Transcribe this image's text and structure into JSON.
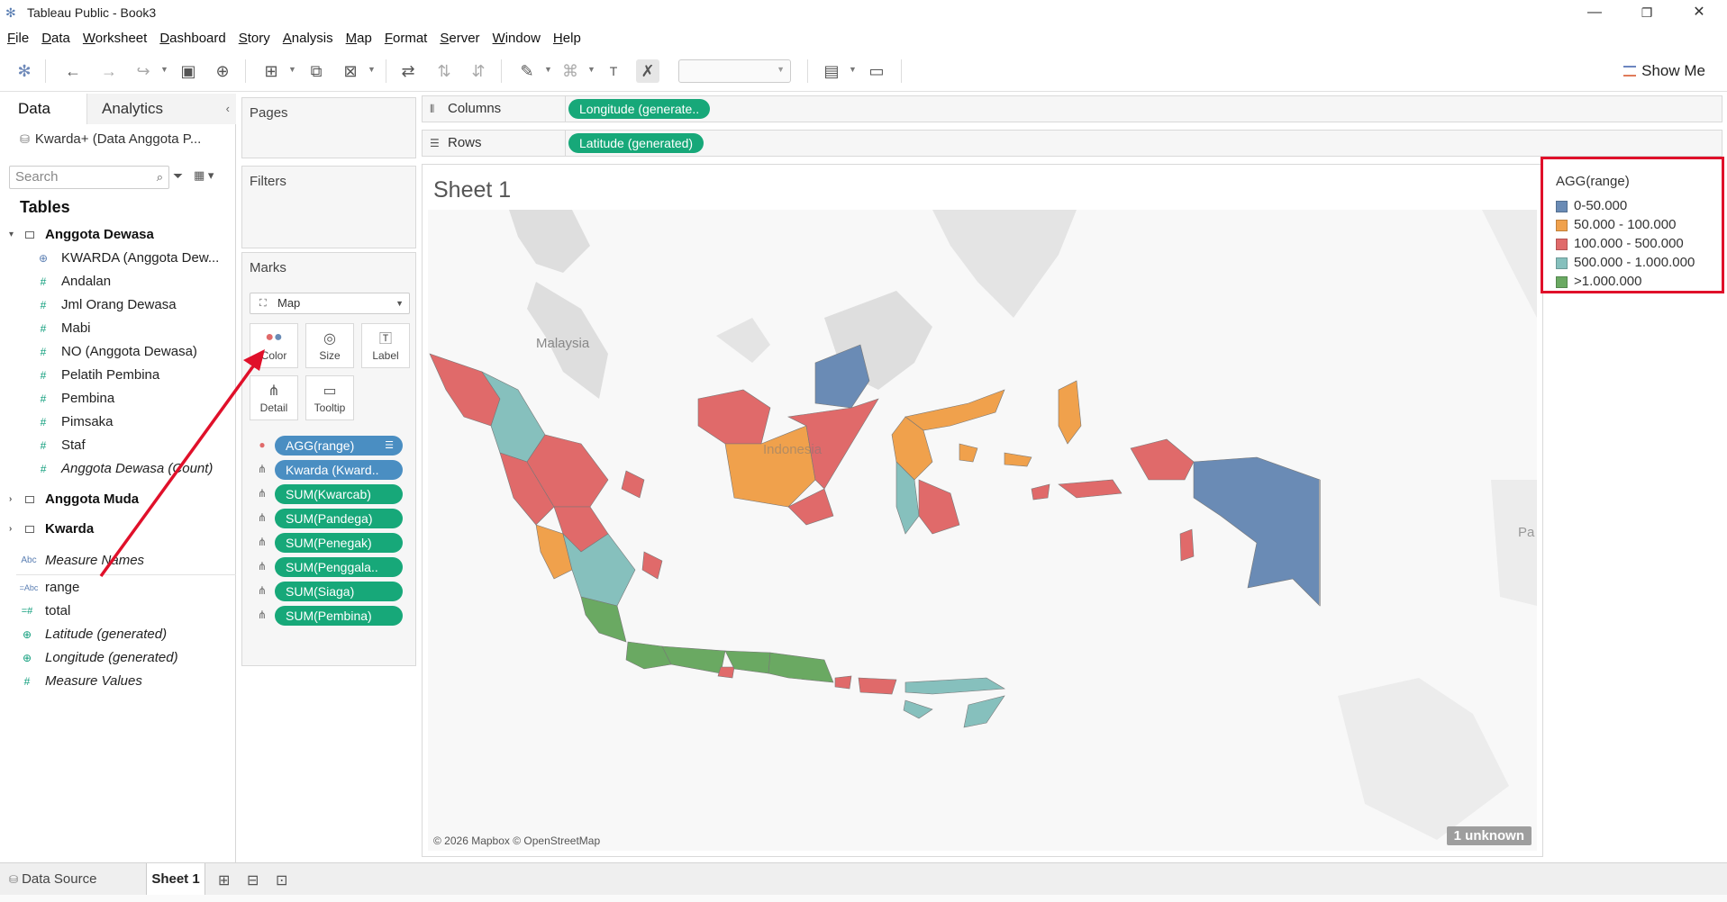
{
  "window": {
    "title": "Tableau Public - Book3",
    "controls": {
      "minimize": "—",
      "restore": "❐",
      "close": "✕"
    }
  },
  "menu": [
    "File",
    "Data",
    "Worksheet",
    "Dashboard",
    "Story",
    "Analysis",
    "Map",
    "Format",
    "Server",
    "Window",
    "Help"
  ],
  "toolbar": {
    "show_me_label": "Show Me"
  },
  "left_pane": {
    "tabs": {
      "data": "Data",
      "analytics": "Analytics"
    },
    "datasource": "Kwarda+ (Data Anggota P...",
    "search_placeholder": "Search",
    "tables_heading": "Tables",
    "tables": [
      {
        "name": "Anggota Dewasa",
        "expanded": true,
        "fields": [
          {
            "name": "KWARDA (Anggota Dew...",
            "type": "geo",
            "italic": false
          },
          {
            "name": "Andalan",
            "type": "measure",
            "italic": false
          },
          {
            "name": "Jml Orang Dewasa",
            "type": "measure",
            "italic": false
          },
          {
            "name": "Mabi",
            "type": "measure",
            "italic": false
          },
          {
            "name": "NO (Anggota Dewasa)",
            "type": "measure",
            "italic": false
          },
          {
            "name": "Pelatih Pembina",
            "type": "measure",
            "italic": false
          },
          {
            "name": "Pembina",
            "type": "measure",
            "italic": false
          },
          {
            "name": "Pimsaka",
            "type": "measure",
            "italic": false
          },
          {
            "name": "Staf",
            "type": "measure",
            "italic": false
          },
          {
            "name": "Anggota Dewasa (Count)",
            "type": "measure",
            "italic": true
          }
        ]
      },
      {
        "name": "Anggota Muda",
        "expanded": false
      },
      {
        "name": "Kwarda",
        "expanded": false
      }
    ],
    "extra_fields": [
      {
        "name": "Measure Names",
        "icon": "Abc",
        "italic": true
      },
      {
        "name": "range",
        "icon": "=Abc",
        "italic": false
      },
      {
        "name": "total",
        "icon": "=#",
        "italic": false
      },
      {
        "name": "Latitude (generated)",
        "icon": "globe",
        "italic": true
      },
      {
        "name": "Longitude (generated)",
        "icon": "globe",
        "italic": true
      },
      {
        "name": "Measure Values",
        "icon": "#",
        "italic": true
      }
    ]
  },
  "cards": {
    "pages_title": "Pages",
    "filters_title": "Filters",
    "marks_title": "Marks",
    "mark_type": "Map",
    "buttons": [
      "Color",
      "Size",
      "Label",
      "Detail",
      "Tooltip"
    ],
    "pills": [
      {
        "label": "AGG(range)",
        "kind": "color",
        "color": "blue"
      },
      {
        "label": "Kwarda (Kward..",
        "kind": "detail",
        "color": "blue"
      },
      {
        "label": "SUM(Kwarcab)",
        "kind": "detail",
        "color": "green"
      },
      {
        "label": "SUM(Pandega)",
        "kind": "detail",
        "color": "green"
      },
      {
        "label": "SUM(Penegak)",
        "kind": "detail",
        "color": "green"
      },
      {
        "label": "SUM(Penggala..",
        "kind": "detail",
        "color": "green"
      },
      {
        "label": "SUM(Siaga)",
        "kind": "detail",
        "color": "green"
      },
      {
        "label": "SUM(Pembina)",
        "kind": "detail",
        "color": "green"
      }
    ]
  },
  "shelves": {
    "columns_label": "Columns",
    "columns_pill": "Longitude (generate..",
    "rows_label": "Rows",
    "rows_pill": "Latitude (generated)"
  },
  "sheet": {
    "title": "Sheet 1",
    "map_labels": {
      "malaysia": "Malaysia",
      "indonesia": "Indonesia",
      "papua": "Pa"
    },
    "attribution": "© 2026 Mapbox © OpenStreetMap",
    "unknown_badge": "1 unknown"
  },
  "legend": {
    "title": "AGG(range)",
    "items": [
      {
        "label": "0-50.000",
        "color": "#6a8bb5"
      },
      {
        "label": "50.000 - 100.000",
        "color": "#f0a14c"
      },
      {
        "label": "100.000 - 500.000",
        "color": "#e06a6a"
      },
      {
        "label": "500.000 - 1.000.000",
        "color": "#86c0bd"
      },
      {
        "label": ">1.000.000",
        "color": "#6aa962"
      }
    ]
  },
  "bottom_tabs": {
    "data_source": "Data Source",
    "sheet1": "Sheet 1"
  }
}
